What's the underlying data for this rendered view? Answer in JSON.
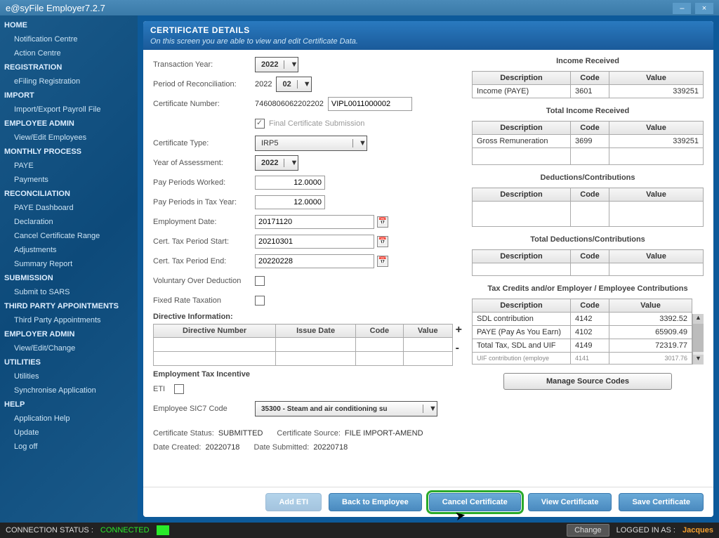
{
  "app": {
    "title": "e@syFile Employer7.2.7"
  },
  "sidebar": [
    {
      "heading": "HOME",
      "items": [
        "Notification Centre",
        "Action Centre"
      ]
    },
    {
      "heading": "REGISTRATION",
      "items": [
        "eFiling Registration"
      ]
    },
    {
      "heading": "IMPORT",
      "items": [
        "Import/Export Payroll File"
      ]
    },
    {
      "heading": "EMPLOYEE ADMIN",
      "items": [
        "View/Edit Employees"
      ]
    },
    {
      "heading": "MONTHLY PROCESS",
      "items": [
        "PAYE",
        "Payments"
      ]
    },
    {
      "heading": "RECONCILIATION",
      "items": [
        "PAYE Dashboard",
        "Declaration",
        "Cancel Certificate Range",
        "Adjustments",
        "Summary Report"
      ]
    },
    {
      "heading": "SUBMISSION",
      "items": [
        "Submit to SARS"
      ]
    },
    {
      "heading": "THIRD PARTY APPOINTMENTS",
      "items": [
        "Third Party Appointments"
      ]
    },
    {
      "heading": "EMPLOYER ADMIN",
      "items": [
        "View/Edit/Change"
      ]
    },
    {
      "heading": "UTILITIES",
      "items": [
        "Utilities",
        "Synchronise Application"
      ]
    },
    {
      "heading": "HELP",
      "items": [
        "Application Help",
        "Update",
        "Log off"
      ]
    }
  ],
  "panel": {
    "title": "CERTIFICATE DETAILS",
    "subtitle": "On this screen you are able to view and edit Certificate Data."
  },
  "form": {
    "trans_year_label": "Transaction Year:",
    "trans_year": "2022",
    "recon_label": "Period of Reconciliation:",
    "recon_year": "2022",
    "recon_period": "02",
    "cert_num_label": "Certificate Number:",
    "cert_num": "7460806062202202",
    "cert_num2": "VIPL0011000002",
    "final_sub_label": "Final Certificate Submission",
    "cert_type_label": "Certificate Type:",
    "cert_type": "IRP5",
    "assess_year_label": "Year of Assessment:",
    "assess_year": "2022",
    "ppw_label": "Pay Periods Worked:",
    "ppw": "12.0000",
    "ppty_label": "Pay Periods in Tax Year:",
    "ppty": "12.0000",
    "emp_date_label": "Employment Date:",
    "emp_date": "20171120",
    "tp_start_label": "Cert. Tax Period Start:",
    "tp_start": "20210301",
    "tp_end_label": "Cert. Tax Period End:",
    "tp_end": "20220228",
    "vod_label": "Voluntary Over Deduction",
    "frt_label": "Fixed Rate Taxation",
    "directive_label": "Directive Information:",
    "directive_cols": [
      "Directive Number",
      "Issue Date",
      "Code",
      "Value"
    ],
    "eti_section": "Employment Tax Incentive",
    "eti_label": "ETI",
    "sic7_label": "Employee SIC7 Code",
    "sic7": "35300 - Steam and air conditioning su",
    "cert_status_label": "Certificate Status:",
    "cert_status": "SUBMITTED",
    "cert_source_label": "Certificate Source:",
    "cert_source": "FILE IMPORT-AMEND",
    "date_created_label": "Date Created:",
    "date_created": "20220718",
    "date_submitted_label": "Date Submitted:",
    "date_submitted": "20220718"
  },
  "right": {
    "s1": {
      "title": "Income Received",
      "cols": [
        "Description",
        "Code",
        "Value"
      ],
      "rows": [
        [
          "Income (PAYE)",
          "3601",
          "339251"
        ]
      ]
    },
    "s2": {
      "title": "Total Income Received",
      "cols": [
        "Description",
        "Code",
        "Value"
      ],
      "rows": [
        [
          "Gross Remuneration",
          "3699",
          "339251"
        ]
      ]
    },
    "s3": {
      "title": "Deductions/Contributions",
      "cols": [
        "Description",
        "Code",
        "Value"
      ],
      "rows": []
    },
    "s4": {
      "title": "Total Deductions/Contributions",
      "cols": [
        "Description",
        "Code",
        "Value"
      ],
      "rows": []
    },
    "s5": {
      "title": "Tax Credits and/or Employer / Employee Contributions",
      "cols": [
        "Description",
        "Code",
        "Value"
      ],
      "rows": [
        [
          "SDL contribution",
          "4142",
          "3392.52"
        ],
        [
          "PAYE (Pay As You Earn)",
          "4102",
          "65909.49"
        ],
        [
          "Total Tax, SDL and UIF",
          "4149",
          "72319.77"
        ],
        [
          "UIF contribution (employe",
          "4141",
          "3017.76"
        ]
      ]
    },
    "manage_btn": "Manage Source Codes"
  },
  "actions": {
    "add_eti": "Add ETI",
    "back": "Back to Employee",
    "cancel": "Cancel Certificate",
    "view": "View Certificate",
    "save": "Save Certificate"
  },
  "status": {
    "conn_label": "CONNECTION STATUS :",
    "conn_value": "CONNECTED",
    "change": "Change",
    "logged_label": "LOGGED IN AS :",
    "user": "Jacques"
  }
}
